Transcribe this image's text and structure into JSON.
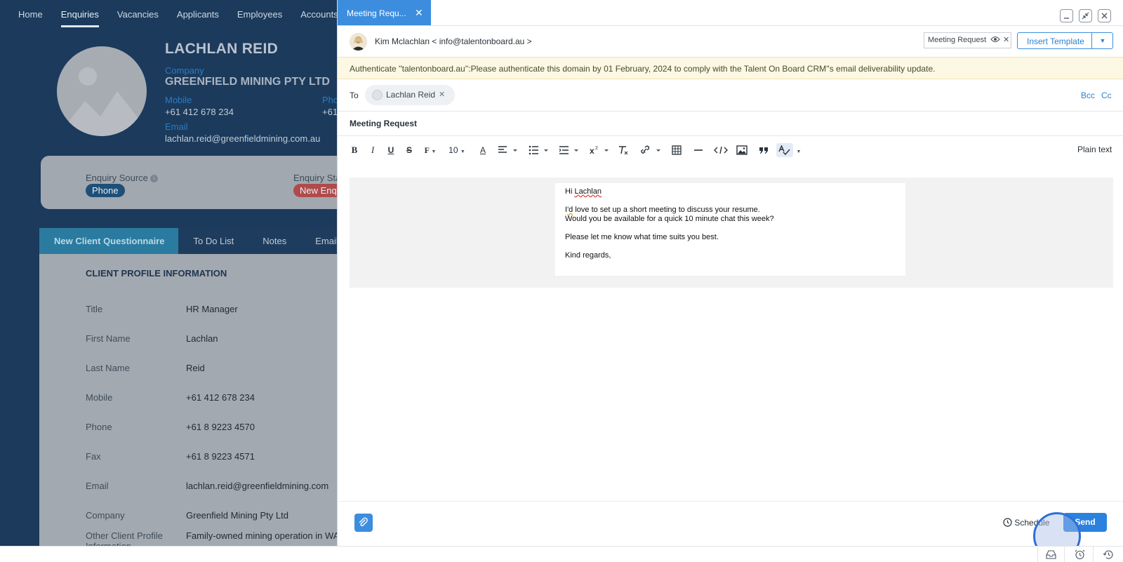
{
  "nav": {
    "items": [
      "Home",
      "Enquiries",
      "Vacancies",
      "Applicants",
      "Employees",
      "Accounts"
    ],
    "active": "Enquiries"
  },
  "contact": {
    "name": "LACHLAN REID",
    "company_label": "Company",
    "company": "GREENFIELD MINING PTY LTD",
    "mobile_label": "Mobile",
    "mobile": "+61 412 678 234",
    "phone_label": "Pho",
    "phone": "+61",
    "email_label": "Email",
    "email": "lachlan.reid@greenfieldmining.com.au"
  },
  "enquiry": {
    "source_label": "Enquiry Source",
    "source_value": "Phone",
    "status_label": "Enquiry Sta",
    "status_value": "New Enq"
  },
  "crm_tabs": [
    "New Client Questionnaire",
    "To Do List",
    "Notes",
    "Emails"
  ],
  "profile": {
    "title": "CLIENT PROFILE INFORMATION",
    "rows": [
      {
        "label": "Title",
        "value": "HR Manager"
      },
      {
        "label": "First Name",
        "value": "Lachlan"
      },
      {
        "label": "Last Name",
        "value": "Reid"
      },
      {
        "label": "Mobile",
        "value": "+61 412 678 234"
      },
      {
        "label": "Phone",
        "value": "+61 8 9223 4570"
      },
      {
        "label": "Fax",
        "value": "+61 8 9223 4571"
      },
      {
        "label": "Email",
        "value": "lachlan.reid@greenfieldmining.com"
      },
      {
        "label": "Company",
        "value": "Greenfield Mining Pty Ltd"
      },
      {
        "label": "Other Client Profile Information",
        "value": "Family-owned mining operation in WA"
      }
    ]
  },
  "compose": {
    "tab_title": "Meeting Requ...",
    "from": "Kim Mclachlan < info@talentonboard.au >",
    "template_tag": "Meeting Request",
    "insert_template": "Insert Template",
    "banner": "Authenticate ''talentonboard.au'':Please authenticate this domain by 01 February, 2024 to comply with the Talent On Board CRM''s email deliverability update.",
    "to_label": "To",
    "recipient": "Lachlan Reid",
    "bcc": "Bcc",
    "cc": "Cc",
    "subject": "Meeting Request",
    "font_size": "10",
    "plain_text": "Plain text",
    "body": {
      "greeting_pre": "Hi ",
      "greeting_name": "Lachlan",
      "line1_pre": "I",
      "line1_mark": "'d",
      "line1_post": " love to set up a short meeting to discuss your resume.",
      "line2": "Would you be available for a quick 10 minute chat this week?",
      "line3": "Please let me know what time suits you best.",
      "line4": "Kind regards,"
    },
    "schedule": "Schedule",
    "send": "Send"
  },
  "colors": {
    "accent": "#3c8dde",
    "nav_bg": "#1b3a5c",
    "banner_bg": "#fcf8e3"
  }
}
